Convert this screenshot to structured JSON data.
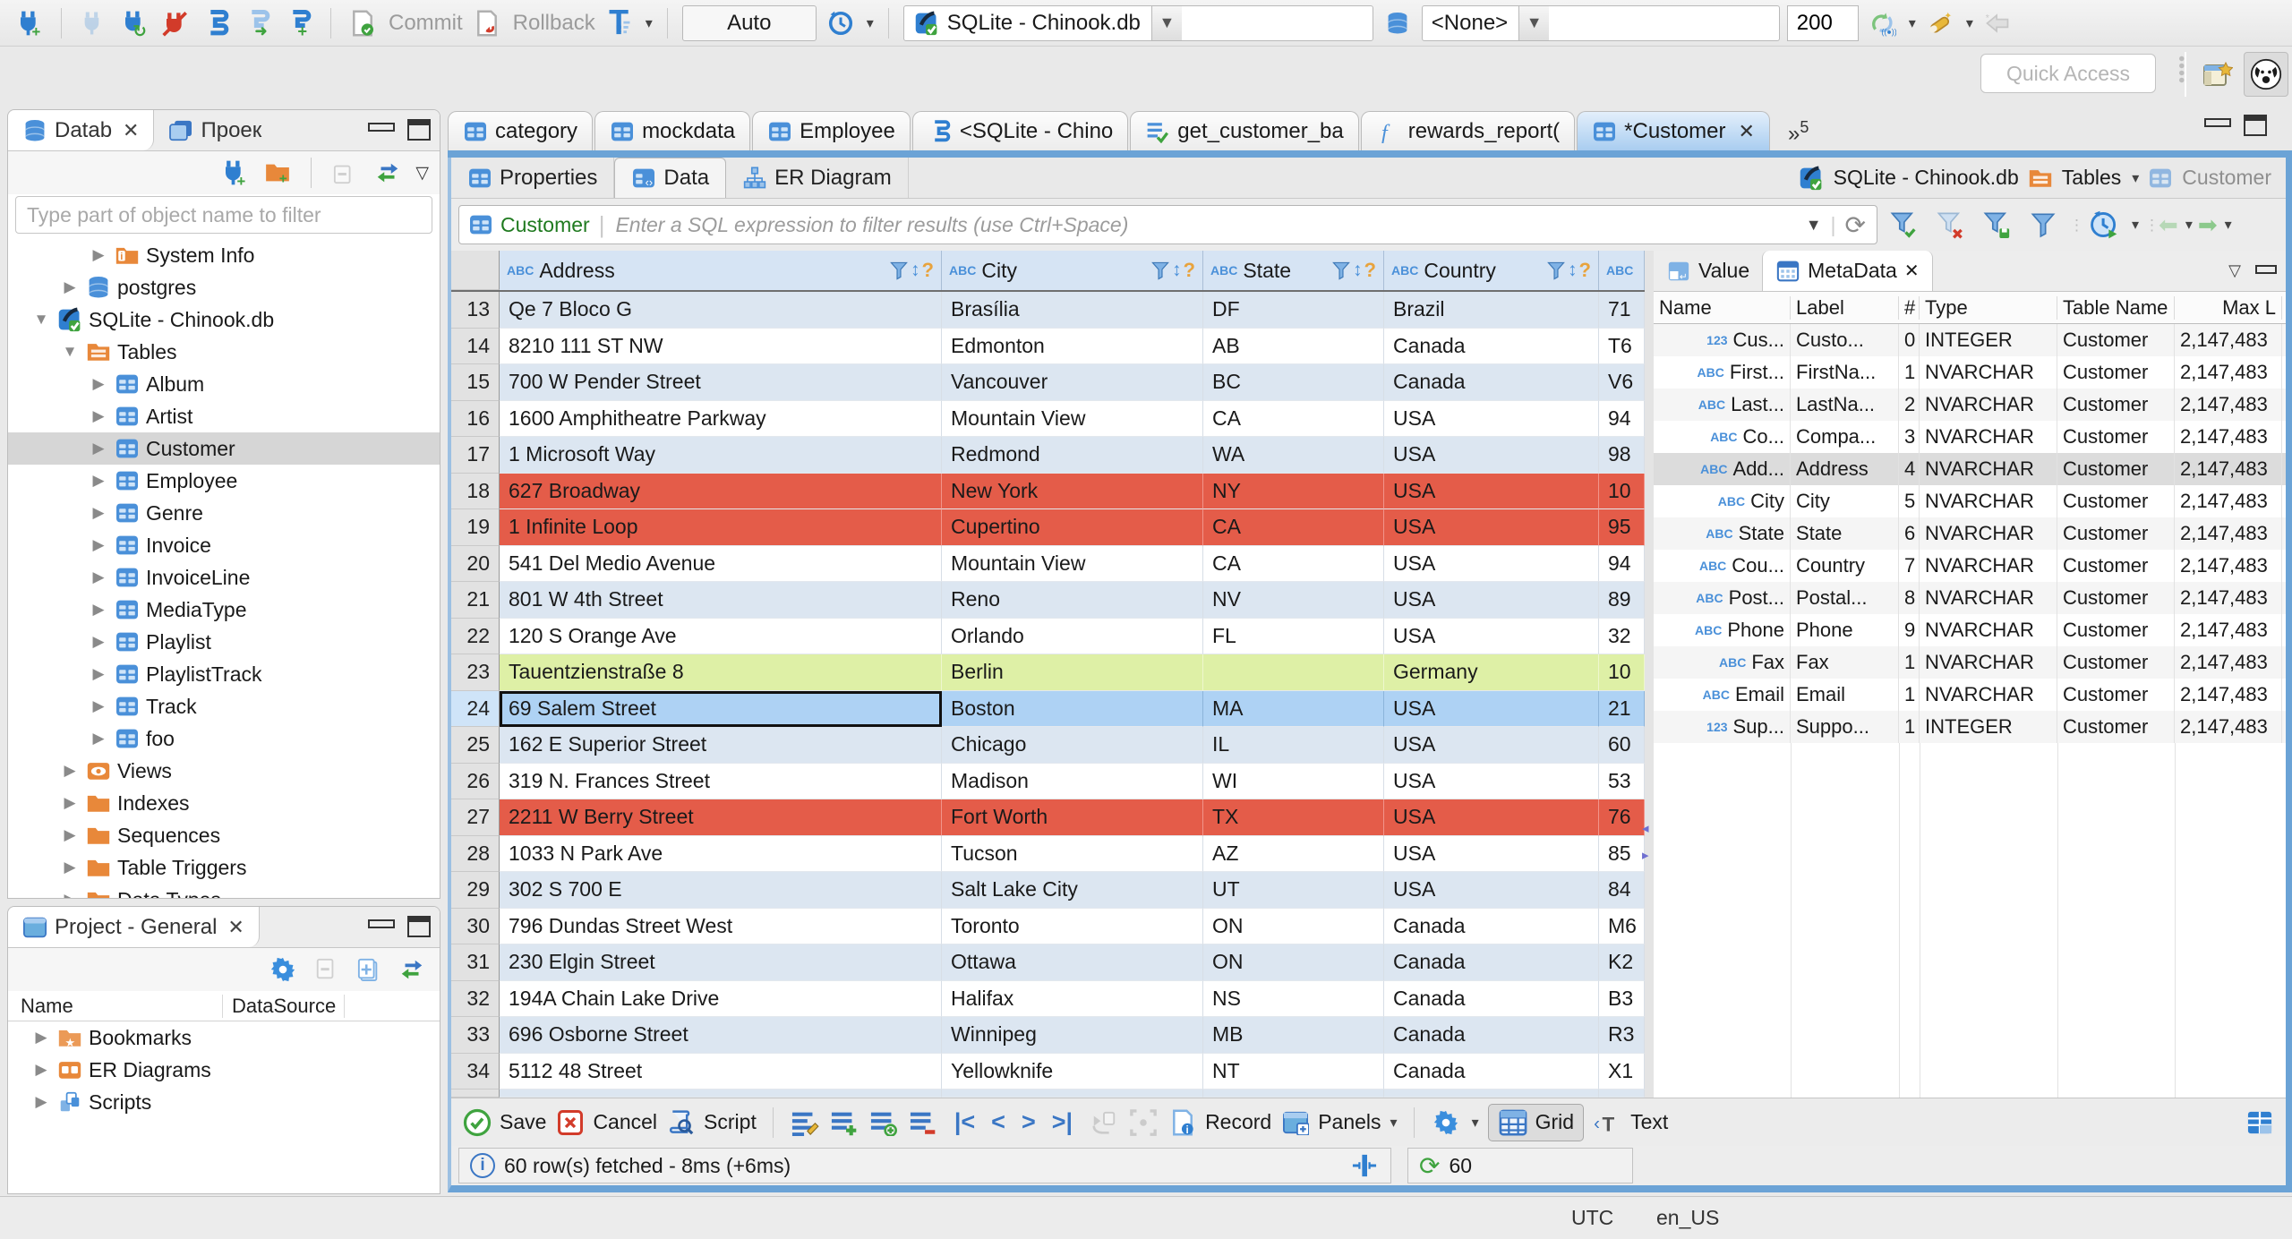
{
  "toolbar": {
    "commit": "Commit",
    "rollback": "Rollback",
    "auto": "Auto",
    "db_combo": "SQLite - Chinook.db",
    "schema_combo": "<None>",
    "fetch_size": "200",
    "quick_access": "Quick Access"
  },
  "navigator": {
    "tab_database": "Datab",
    "tab_projects": "Проек",
    "filter_placeholder": "Type part of object name to filter",
    "tree": [
      {
        "label": "System Info",
        "icon": "folder-info",
        "level": 2,
        "arrow": "right"
      },
      {
        "label": "postgres",
        "icon": "db",
        "level": 1,
        "arrow": "right"
      },
      {
        "label": "SQLite - Chinook.db",
        "icon": "sqlite",
        "level": 0,
        "arrow": "down"
      },
      {
        "label": "Tables",
        "icon": "folder-table",
        "level": 1,
        "arrow": "down"
      },
      {
        "label": "Album",
        "icon": "table",
        "level": 2,
        "arrow": "right"
      },
      {
        "label": "Artist",
        "icon": "table",
        "level": 2,
        "arrow": "right"
      },
      {
        "label": "Customer",
        "icon": "table",
        "level": 2,
        "arrow": "right",
        "selected": true
      },
      {
        "label": "Employee",
        "icon": "table",
        "level": 2,
        "arrow": "right"
      },
      {
        "label": "Genre",
        "icon": "table",
        "level": 2,
        "arrow": "right"
      },
      {
        "label": "Invoice",
        "icon": "table",
        "level": 2,
        "arrow": "right"
      },
      {
        "label": "InvoiceLine",
        "icon": "table",
        "level": 2,
        "arrow": "right"
      },
      {
        "label": "MediaType",
        "icon": "table",
        "level": 2,
        "arrow": "right"
      },
      {
        "label": "Playlist",
        "icon": "table",
        "level": 2,
        "arrow": "right"
      },
      {
        "label": "PlaylistTrack",
        "icon": "table",
        "level": 2,
        "arrow": "right"
      },
      {
        "label": "Track",
        "icon": "table",
        "level": 2,
        "arrow": "right"
      },
      {
        "label": "foo",
        "icon": "table",
        "level": 2,
        "arrow": "right"
      },
      {
        "label": "Views",
        "icon": "folder-eye",
        "level": 1,
        "arrow": "right"
      },
      {
        "label": "Indexes",
        "icon": "folder",
        "level": 1,
        "arrow": "right"
      },
      {
        "label": "Sequences",
        "icon": "folder",
        "level": 1,
        "arrow": "right"
      },
      {
        "label": "Table Triggers",
        "icon": "folder",
        "level": 1,
        "arrow": "right"
      },
      {
        "label": "Data Types",
        "icon": "folder",
        "level": 1,
        "arrow": "right"
      }
    ]
  },
  "project_panel": {
    "tab": "Project - General",
    "columns": [
      "Name",
      "DataSource"
    ],
    "items": [
      {
        "label": "Bookmarks",
        "icon": "folder-star"
      },
      {
        "label": "ER Diagrams",
        "icon": "er"
      },
      {
        "label": "Scripts",
        "icon": "pages"
      }
    ]
  },
  "editor": {
    "tabs": [
      {
        "label": "category",
        "icon": "table"
      },
      {
        "label": "mockdata",
        "icon": "table"
      },
      {
        "label": "Employee",
        "icon": "table"
      },
      {
        "label": "<SQLite - Chino",
        "icon": "sqlpage"
      },
      {
        "label": "get_customer_ba",
        "icon": "listcheck"
      },
      {
        "label": "rewards_report(",
        "icon": "func"
      },
      {
        "label": "*Customer",
        "icon": "table",
        "active": true,
        "closable": true
      }
    ],
    "overflow_count": "5",
    "subtabs": [
      "Properties",
      "Data",
      "ER Diagram"
    ],
    "active_subtab": "Data",
    "breadcrumb": {
      "db": "SQLite - Chinook.db",
      "container": "Tables",
      "entity": "Customer"
    },
    "filter_entity": "Customer",
    "filter_placeholder": "Enter a SQL expression to filter results (use Ctrl+Space)"
  },
  "grid": {
    "columns": [
      "Address",
      "City",
      "State",
      "Country"
    ],
    "rows": [
      {
        "n": "13",
        "cells": [
          "Qe 7 Bloco G",
          "Brasília",
          "DF",
          "Brazil",
          "71"
        ],
        "color": "alt"
      },
      {
        "n": "14",
        "cells": [
          "8210 111 ST NW",
          "Edmonton",
          "AB",
          "Canada",
          "T6"
        ],
        "color": "white"
      },
      {
        "n": "15",
        "cells": [
          "700 W Pender Street",
          "Vancouver",
          "BC",
          "Canada",
          "V6"
        ],
        "color": "alt"
      },
      {
        "n": "16",
        "cells": [
          "1600 Amphitheatre Parkway",
          "Mountain View",
          "CA",
          "USA",
          "94"
        ],
        "color": "white"
      },
      {
        "n": "17",
        "cells": [
          "1 Microsoft Way",
          "Redmond",
          "WA",
          "USA",
          "98"
        ],
        "color": "alt"
      },
      {
        "n": "18",
        "cells": [
          "627 Broadway",
          "New York",
          "NY",
          "USA",
          "10"
        ],
        "color": "red"
      },
      {
        "n": "19",
        "cells": [
          "1 Infinite Loop",
          "Cupertino",
          "CA",
          "USA",
          "95"
        ],
        "color": "red"
      },
      {
        "n": "20",
        "cells": [
          "541 Del Medio Avenue",
          "Mountain View",
          "CA",
          "USA",
          "94"
        ],
        "color": "white"
      },
      {
        "n": "21",
        "cells": [
          "801 W 4th Street",
          "Reno",
          "NV",
          "USA",
          "89"
        ],
        "color": "alt"
      },
      {
        "n": "22",
        "cells": [
          "120 S Orange Ave",
          "Orlando",
          "FL",
          "USA",
          "32"
        ],
        "color": "white"
      },
      {
        "n": "23",
        "cells": [
          "Tauentzienstraße 8",
          "Berlin",
          "",
          "Germany",
          "10"
        ],
        "color": "green"
      },
      {
        "n": "24",
        "cells": [
          "69 Salem Street",
          "Boston",
          "MA",
          "USA",
          "21"
        ],
        "color": "sel",
        "focus_cell": 0
      },
      {
        "n": "25",
        "cells": [
          "162 E Superior Street",
          "Chicago",
          "IL",
          "USA",
          "60"
        ],
        "color": "alt"
      },
      {
        "n": "26",
        "cells": [
          "319 N. Frances Street",
          "Madison",
          "WI",
          "USA",
          "53"
        ],
        "color": "white"
      },
      {
        "n": "27",
        "cells": [
          "2211 W Berry Street",
          "Fort Worth",
          "TX",
          "USA",
          "76"
        ],
        "color": "red"
      },
      {
        "n": "28",
        "cells": [
          "1033 N Park Ave",
          "Tucson",
          "AZ",
          "USA",
          "85"
        ],
        "color": "white"
      },
      {
        "n": "29",
        "cells": [
          "302 S 700 E",
          "Salt Lake City",
          "UT",
          "USA",
          "84"
        ],
        "color": "alt"
      },
      {
        "n": "30",
        "cells": [
          "796 Dundas Street West",
          "Toronto",
          "ON",
          "Canada",
          "M6"
        ],
        "color": "white"
      },
      {
        "n": "31",
        "cells": [
          "230 Elgin Street",
          "Ottawa",
          "ON",
          "Canada",
          "K2"
        ],
        "color": "alt"
      },
      {
        "n": "32",
        "cells": [
          "194A Chain Lake Drive",
          "Halifax",
          "NS",
          "Canada",
          "B3"
        ],
        "color": "white"
      },
      {
        "n": "33",
        "cells": [
          "696 Osborne Street",
          "Winnipeg",
          "MB",
          "Canada",
          "R3"
        ],
        "color": "alt"
      },
      {
        "n": "34",
        "cells": [
          "5112 48 Street",
          "Yellowknife",
          "NT",
          "Canada",
          "X1"
        ],
        "color": "white"
      }
    ]
  },
  "metadata": {
    "tab_value": "Value",
    "tab_metadata": "MetaData",
    "columns": [
      "Name",
      "Label",
      "#",
      "Type",
      "Table Name",
      "Max L"
    ],
    "rows": [
      {
        "icon": "123",
        "name": "Cus...",
        "label": "Custo...",
        "num": "0",
        "type": "INTEGER",
        "table": "Customer",
        "max": "2,147,483"
      },
      {
        "icon": "ABC",
        "name": "First...",
        "label": "FirstNa...",
        "num": "1",
        "type": "NVARCHAR",
        "table": "Customer",
        "max": "2,147,483"
      },
      {
        "icon": "ABC",
        "name": "Last...",
        "label": "LastNa...",
        "num": "2",
        "type": "NVARCHAR",
        "table": "Customer",
        "max": "2,147,483"
      },
      {
        "icon": "ABC",
        "name": "Co...",
        "label": "Compa...",
        "num": "3",
        "type": "NVARCHAR",
        "table": "Customer",
        "max": "2,147,483"
      },
      {
        "icon": "ABC",
        "name": "Add...",
        "label": "Address",
        "num": "4",
        "type": "NVARCHAR",
        "table": "Customer",
        "max": "2,147,483",
        "selected": true
      },
      {
        "icon": "ABC",
        "name": "City",
        "label": "City",
        "num": "5",
        "type": "NVARCHAR",
        "table": "Customer",
        "max": "2,147,483"
      },
      {
        "icon": "ABC",
        "name": "State",
        "label": "State",
        "num": "6",
        "type": "NVARCHAR",
        "table": "Customer",
        "max": "2,147,483"
      },
      {
        "icon": "ABC",
        "name": "Cou...",
        "label": "Country",
        "num": "7",
        "type": "NVARCHAR",
        "table": "Customer",
        "max": "2,147,483"
      },
      {
        "icon": "ABC",
        "name": "Post...",
        "label": "Postal...",
        "num": "8",
        "type": "NVARCHAR",
        "table": "Customer",
        "max": "2,147,483"
      },
      {
        "icon": "ABC",
        "name": "Phone",
        "label": "Phone",
        "num": "9",
        "type": "NVARCHAR",
        "table": "Customer",
        "max": "2,147,483"
      },
      {
        "icon": "ABC",
        "name": "Fax",
        "label": "Fax",
        "num": "1",
        "type": "NVARCHAR",
        "table": "Customer",
        "max": "2,147,483"
      },
      {
        "icon": "ABC",
        "name": "Email",
        "label": "Email",
        "num": "1",
        "type": "NVARCHAR",
        "table": "Customer",
        "max": "2,147,483"
      },
      {
        "icon": "123",
        "name": "Sup...",
        "label": "Suppo...",
        "num": "1",
        "type": "INTEGER",
        "table": "Customer",
        "max": "2,147,483"
      }
    ]
  },
  "bottombar": {
    "save": "Save",
    "cancel": "Cancel",
    "script": "Script",
    "record": "Record",
    "panels": "Panels",
    "grid": "Grid",
    "text": "Text"
  },
  "status": {
    "fetched": "60 row(s) fetched - 8ms (+6ms)",
    "refresh_count": "60"
  },
  "window_statusbar": {
    "timezone": "UTC",
    "locale": "en_US"
  }
}
